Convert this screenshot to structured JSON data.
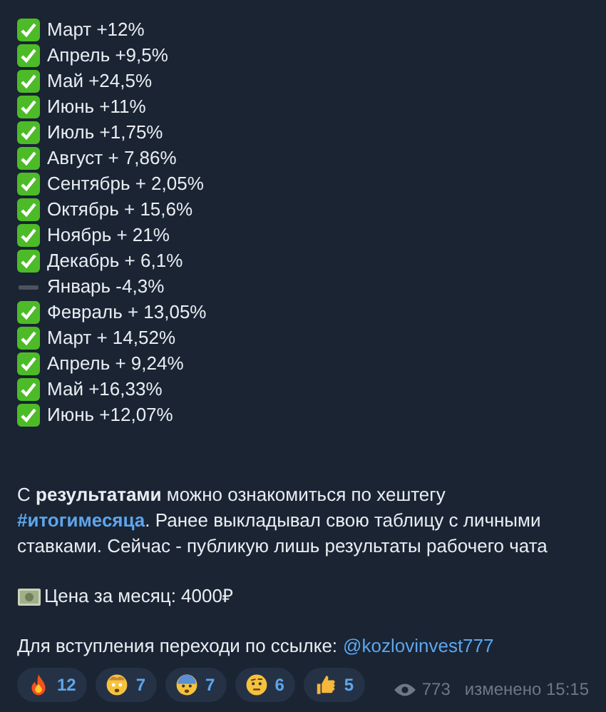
{
  "results": [
    {
      "text": "Март +12%",
      "checked": true
    },
    {
      "text": "Апрель +9,5%",
      "checked": true
    },
    {
      "text": "Май +24,5%",
      "checked": true
    },
    {
      "text": "Июнь +11%",
      "checked": true
    },
    {
      "text": "Июль +1,75%",
      "checked": true
    },
    {
      "text": "Август + 7,86%",
      "checked": true
    },
    {
      "text": "Сентябрь + 2,05%",
      "checked": true
    },
    {
      "text": "Октябрь + 15,6%",
      "checked": true
    },
    {
      "text": "Ноябрь + 21%",
      "checked": true
    },
    {
      "text": "Декабрь + 6,1%",
      "checked": true
    },
    {
      "text": "Январь -4,3%",
      "checked": false
    },
    {
      "text": "Февраль + 13,05%",
      "checked": true
    },
    {
      "text": "Март + 14,52%",
      "checked": true
    },
    {
      "text": "Апрель + 9,24%",
      "checked": true
    },
    {
      "text": "Май +16,33%",
      "checked": true
    },
    {
      "text": "Июнь +12,07%",
      "checked": true
    }
  ],
  "info": {
    "before_link": "С **результатами** можно ознакомиться по хештегу",
    "link": "#итогимесяца",
    "after_link": ". Ранее выкладывал свою таблицу с личными ставками. Сейчас - публикую лишь результаты рабочего чата"
  },
  "price": "Цена за месяц: 4000₽",
  "join": {
    "text": "Для вступления переходи по ссылке:",
    "link": "@kozlovinvest777"
  },
  "reactions": [
    {
      "kind": "fire",
      "count": "12"
    },
    {
      "kind": "exploding",
      "count": "7"
    },
    {
      "kind": "scared",
      "count": "7"
    },
    {
      "kind": "raised-brow",
      "count": "6"
    },
    {
      "kind": "thumbs-up",
      "count": "5"
    }
  ],
  "views": "773",
  "edited": "изменено 15:15"
}
